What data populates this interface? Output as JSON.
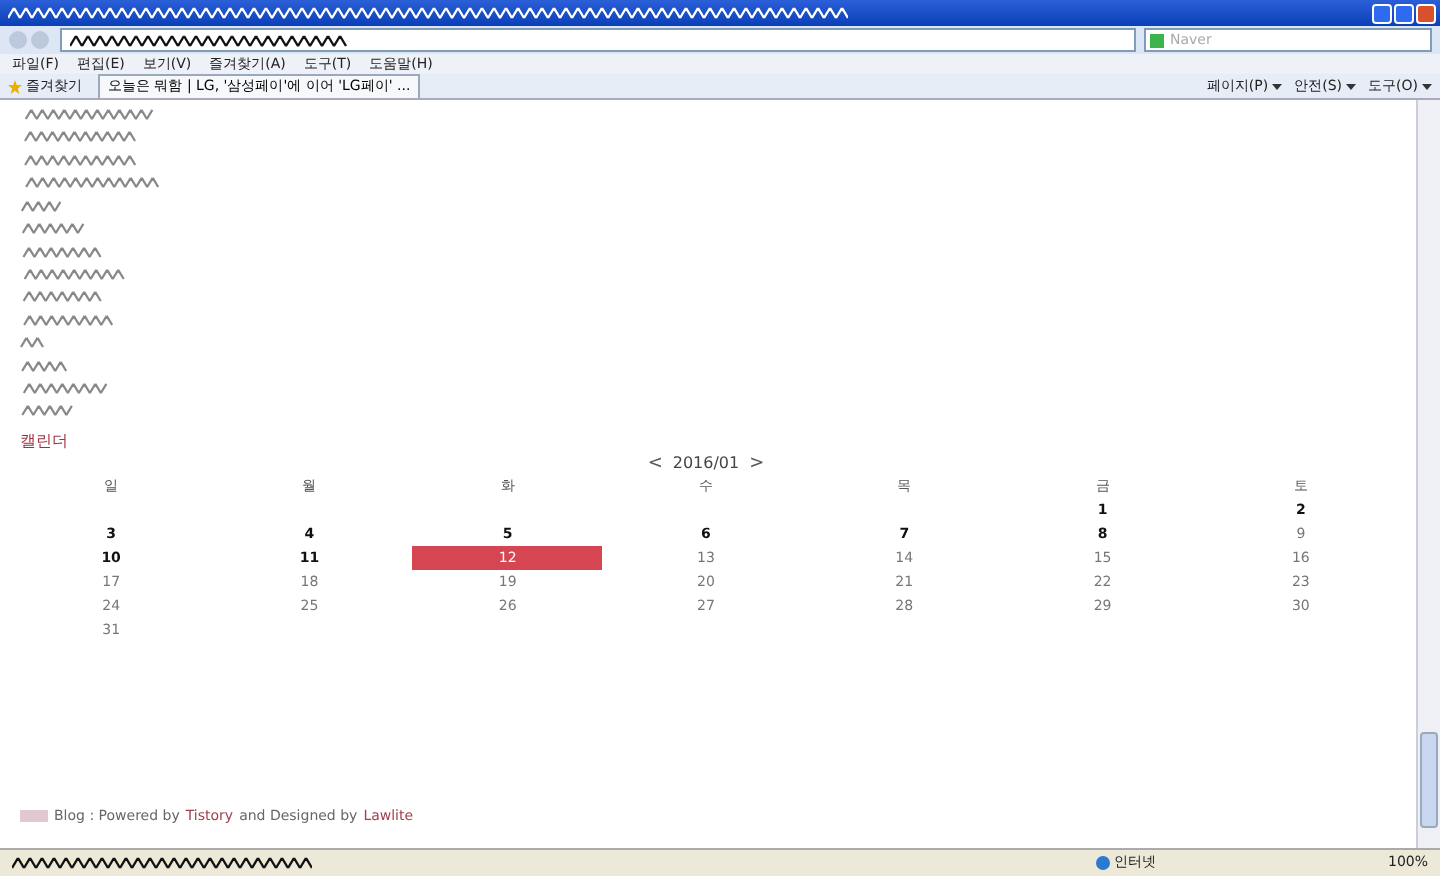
{
  "browser": {
    "search_placeholder": "Naver",
    "menu": [
      "파일(F)",
      "편집(E)",
      "보기(V)",
      "즐겨찾기(A)",
      "도구(T)",
      "도움말(H)"
    ],
    "favorites": "즐겨찾기",
    "tab": "오늘은 뭐함 | LG, '삼성페이'에 이어 'LG페이' ...",
    "commands": [
      "페이지(P)",
      "안전(S)",
      "도구(O)"
    ],
    "status": {
      "zone": "인터넷",
      "zoom": "100%"
    }
  },
  "calendar": {
    "heading": "캘린더",
    "prev": "<",
    "month": "2016/01",
    "next": ">",
    "weekdays": [
      "일",
      "월",
      "화",
      "수",
      "목",
      "금",
      "토"
    ],
    "weeks": [
      {
        "pad_before": true,
        "days": [
          {
            "day": "1",
            "bold": true,
            "selected": false
          },
          {
            "day": "2",
            "bold": true,
            "selected": false
          }
        ]
      },
      {
        "days": [
          {
            "day": "3",
            "bold": true,
            "selected": false
          },
          {
            "day": "4",
            "bold": true,
            "selected": false
          },
          {
            "day": "5",
            "bold": true,
            "selected": false
          },
          {
            "day": "6",
            "bold": true,
            "selected": false
          },
          {
            "day": "7",
            "bold": true,
            "selected": false
          },
          {
            "day": "8",
            "bold": true,
            "selected": false
          },
          {
            "day": "9",
            "bold": false,
            "selected": false
          }
        ]
      },
      {
        "days": [
          {
            "day": "10",
            "bold": true,
            "selected": false
          },
          {
            "day": "11",
            "bold": true,
            "selected": false
          },
          {
            "day": "12",
            "bold": false,
            "selected": true
          },
          {
            "day": "13",
            "bold": false,
            "selected": false
          },
          {
            "day": "14",
            "bold": false,
            "selected": false
          },
          {
            "day": "15",
            "bold": false,
            "selected": false
          },
          {
            "day": "16",
            "bold": false,
            "selected": false
          }
        ]
      },
      {
        "days": [
          {
            "day": "17",
            "bold": false,
            "selected": false
          },
          {
            "day": "18",
            "bold": false,
            "selected": false
          },
          {
            "day": "19",
            "bold": false,
            "selected": false
          },
          {
            "day": "20",
            "bold": false,
            "selected": false
          },
          {
            "day": "21",
            "bold": false,
            "selected": false
          },
          {
            "day": "22",
            "bold": false,
            "selected": false
          },
          {
            "day": "23",
            "bold": false,
            "selected": false
          }
        ]
      },
      {
        "days": [
          {
            "day": "24",
            "bold": false,
            "selected": false
          },
          {
            "day": "25",
            "bold": false,
            "selected": false
          },
          {
            "day": "26",
            "bold": false,
            "selected": false
          },
          {
            "day": "27",
            "bold": false,
            "selected": false
          },
          {
            "day": "28",
            "bold": false,
            "selected": false
          },
          {
            "day": "29",
            "bold": false,
            "selected": false
          },
          {
            "day": "30",
            "bold": false,
            "selected": false
          }
        ]
      },
      {
        "pad_before": false,
        "days": [
          {
            "day": "31",
            "bold": false,
            "selected": false
          }
        ]
      }
    ]
  },
  "footer": {
    "blog": "Blog : Powered by",
    "tistory": "Tistory",
    "and": "and Designed by",
    "designer": "Lawlite"
  }
}
